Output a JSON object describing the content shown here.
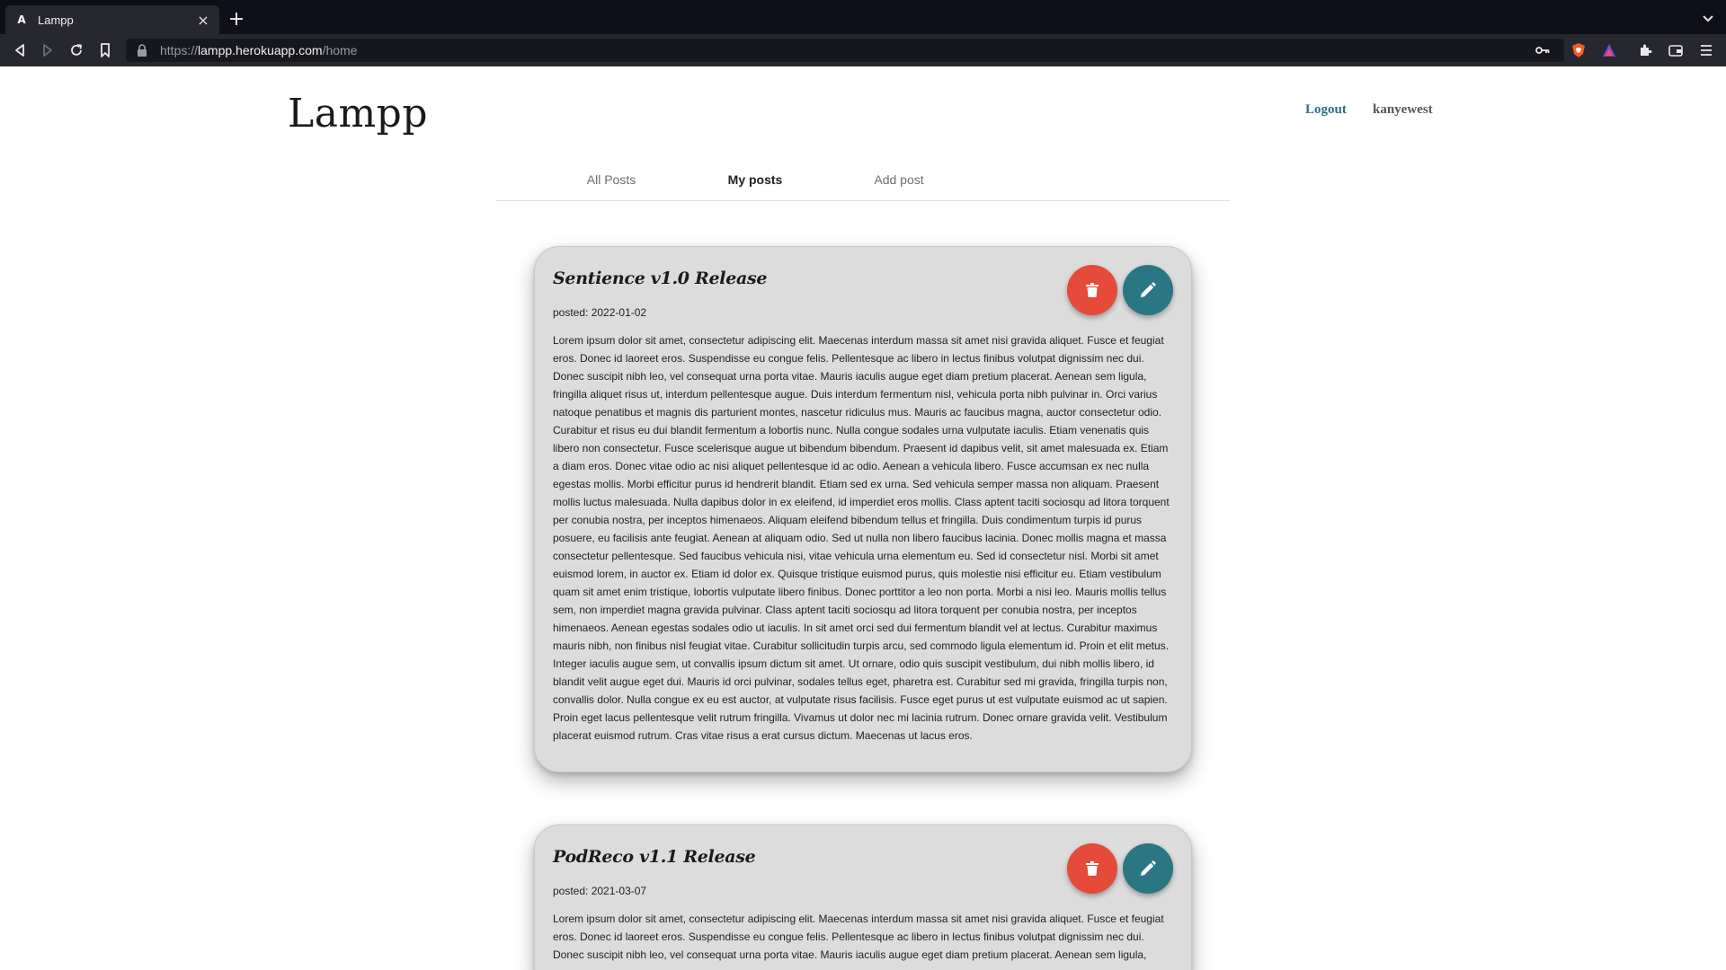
{
  "browser": {
    "tab_title": "Lampp",
    "tab_favicon": "A",
    "url_scheme": "https://",
    "url_host": "lampp.herokuapp.com",
    "url_path": "/home",
    "icons": [
      "back-icon",
      "forward-icon",
      "reload-icon",
      "bookmark-icon",
      "lock-icon",
      "key-icon",
      "brave-shield-icon",
      "brave-rewards-icon",
      "extensions-icon",
      "wallet-icon",
      "menu-icon"
    ]
  },
  "header": {
    "logo": "Lampp",
    "logout_label": "Logout",
    "username": "kanyewest"
  },
  "nav": {
    "tabs": [
      {
        "label": "All Posts"
      },
      {
        "label": "My posts"
      },
      {
        "label": "Add post"
      }
    ],
    "active_index": 1
  },
  "posts": [
    {
      "title": "Sentience v1.0 Release",
      "date": "posted: 2022-01-02",
      "body": "Lorem ipsum dolor sit amet, consectetur adipiscing elit. Maecenas interdum massa sit amet nisi gravida aliquet. Fusce et feugiat eros. Donec id laoreet eros. Suspendisse eu congue felis. Pellentesque ac libero in lectus finibus volutpat dignissim nec dui. Donec suscipit nibh leo, vel consequat urna porta vitae. Mauris iaculis augue eget diam pretium placerat. Aenean sem ligula, fringilla aliquet risus ut, interdum pellentesque augue. Duis interdum fermentum nisl, vehicula porta nibh pulvinar in. Orci varius natoque penatibus et magnis dis parturient montes, nascetur ridiculus mus. Mauris ac faucibus magna, auctor consectetur odio. Curabitur et risus eu dui blandit fermentum a lobortis nunc. Nulla congue sodales urna vulputate iaculis. Etiam venenatis quis libero non consectetur. Fusce scelerisque augue ut bibendum bibendum. Praesent id dapibus velit, sit amet malesuada ex. Etiam a diam eros. Donec vitae odio ac nisi aliquet pellentesque id ac odio. Aenean a vehicula libero. Fusce accumsan ex nec nulla egestas mollis. Morbi efficitur purus id hendrerit blandit. Etiam sed ex urna. Sed vehicula semper massa non aliquam. Praesent mollis luctus malesuada. Nulla dapibus dolor in ex eleifend, id imperdiet eros mollis. Class aptent taciti sociosqu ad litora torquent per conubia nostra, per inceptos himenaeos. Aliquam eleifend bibendum tellus et fringilla. Duis condimentum turpis id purus posuere, eu facilisis ante feugiat. Aenean at aliquam odio. Sed ut nulla non libero faucibus lacinia. Donec mollis magna et massa consectetur pellentesque. Sed faucibus vehicula nisi, vitae vehicula urna elementum eu. Sed id consectetur nisl. Morbi sit amet euismod lorem, in auctor ex. Etiam id dolor ex. Quisque tristique euismod purus, quis molestie nisi efficitur eu. Etiam vestibulum quam sit amet enim tristique, lobortis vulputate libero finibus. Donec porttitor a leo non porta. Morbi a nisi leo. Mauris mollis tellus sem, non imperdiet magna gravida pulvinar. Class aptent taciti sociosqu ad litora torquent per conubia nostra, per inceptos himenaeos. Aenean egestas sodales odio ut iaculis. In sit amet orci sed dui fermentum blandit vel at lectus. Curabitur maximus mauris nibh, non finibus nisl feugiat vitae. Curabitur sollicitudin turpis arcu, sed commodo ligula elementum id. Proin et elit metus. Integer iaculis augue sem, ut convallis ipsum dictum sit amet. Ut ornare, odio quis suscipit vestibulum, dui nibh mollis libero, id blandit velit augue eget dui. Mauris id orci pulvinar, sodales tellus eget, pharetra est. Curabitur sed mi gravida, fringilla turpis non, convallis dolor. Nulla congue ex eu est auctor, at vulputate risus facilisis. Fusce eget purus ut est vulputate euismod ac ut sapien. Proin eget lacus pellentesque velit rutrum fringilla. Vivamus ut dolor nec mi lacinia rutrum. Donec ornare gravida velit. Vestibulum placerat euismod rutrum. Cras vitae risus a erat cursus dictum. Maecenas ut lacus eros."
    },
    {
      "title": "PodReco v1.1 Release",
      "date": "posted: 2021-03-07",
      "body": "Lorem ipsum dolor sit amet, consectetur adipiscing elit. Maecenas interdum massa sit amet nisi gravida aliquet. Fusce et feugiat eros. Donec id laoreet eros. Suspendisse eu congue felis. Pellentesque ac libero in lectus finibus volutpat dignissim nec dui. Donec suscipit nibh leo, vel consequat urna porta vitae. Mauris iaculis augue eget diam pretium placerat. Aenean sem ligula,"
    }
  ],
  "colors": {
    "delete": "#e54a3a",
    "edit": "#2b7683",
    "card_bg": "#dcdcdc",
    "logout": "#2a7080"
  }
}
